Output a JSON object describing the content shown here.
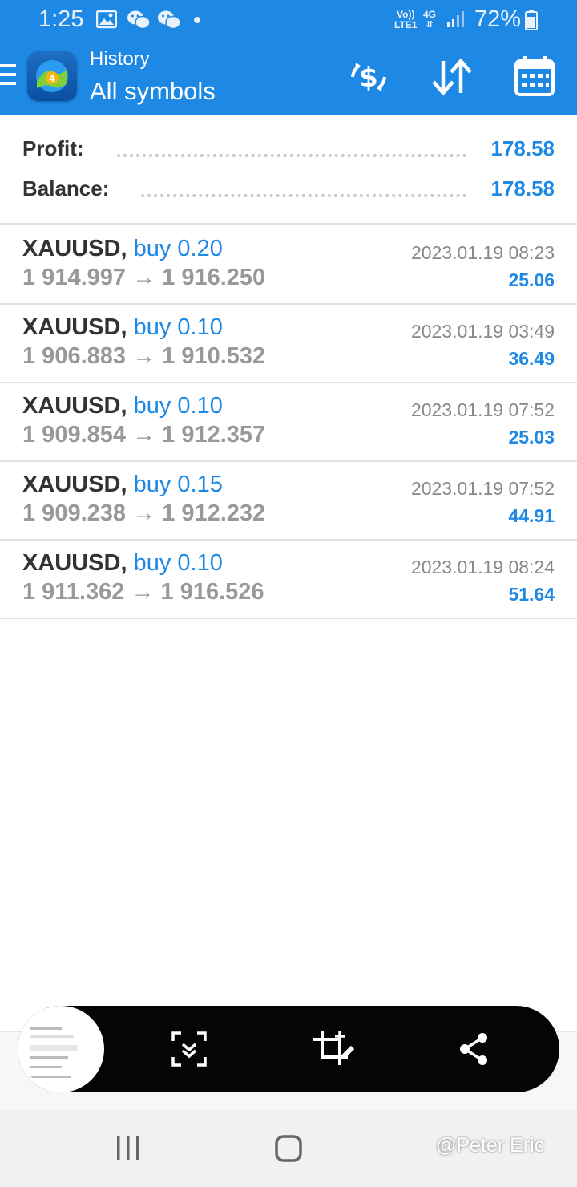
{
  "status_bar": {
    "time": "1:25",
    "network_top": "Vo))",
    "network_bottom": "LTE1",
    "data_type": "4G",
    "battery": "72%"
  },
  "app_bar": {
    "title": "History",
    "subtitle": "All symbols",
    "icons": [
      "menu-icon",
      "app-logo",
      "currency-exchange-icon",
      "sort-icon",
      "calendar-icon"
    ]
  },
  "summary": {
    "profit_label": "Profit:",
    "profit_value": "178.58",
    "balance_label": "Balance:",
    "balance_value": "178.58"
  },
  "deals": [
    {
      "symbol": "XAUUSD,",
      "side": "buy 0.20",
      "prices": "1 914.997 → 1 916.250",
      "time": "2023.01.19 08:23",
      "profit": "25.06"
    },
    {
      "symbol": "XAUUSD,",
      "side": "buy 0.10",
      "prices": "1 906.883 → 1 910.532",
      "time": "2023.01.19 03:49",
      "profit": "36.49"
    },
    {
      "symbol": "XAUUSD,",
      "side": "buy 0.10",
      "prices": "1 909.854 → 1 912.357",
      "time": "2023.01.19 07:52",
      "profit": "25.03"
    },
    {
      "symbol": "XAUUSD,",
      "side": "buy 0.15",
      "prices": "1 909.238 → 1 912.232",
      "time": "2023.01.19 07:52",
      "profit": "44.91"
    },
    {
      "symbol": "XAUUSD,",
      "side": "buy 0.10",
      "prices": "1 911.362 → 1 916.526",
      "time": "2023.01.19 08:24",
      "profit": "51.64"
    }
  ],
  "screenshot_toolbar": {
    "icons": [
      "screenshot-thumbnail",
      "scroll-capture-icon",
      "crop-edit-icon",
      "share-icon"
    ]
  },
  "nav_bar": {
    "icons": [
      "recents-icon",
      "home-icon"
    ],
    "watermark": "@Peter Eric"
  },
  "colors": {
    "accent": "#1E88E5",
    "text_dark": "#333333",
    "text_gray": "#999999",
    "divider": "#e2e2e2"
  }
}
